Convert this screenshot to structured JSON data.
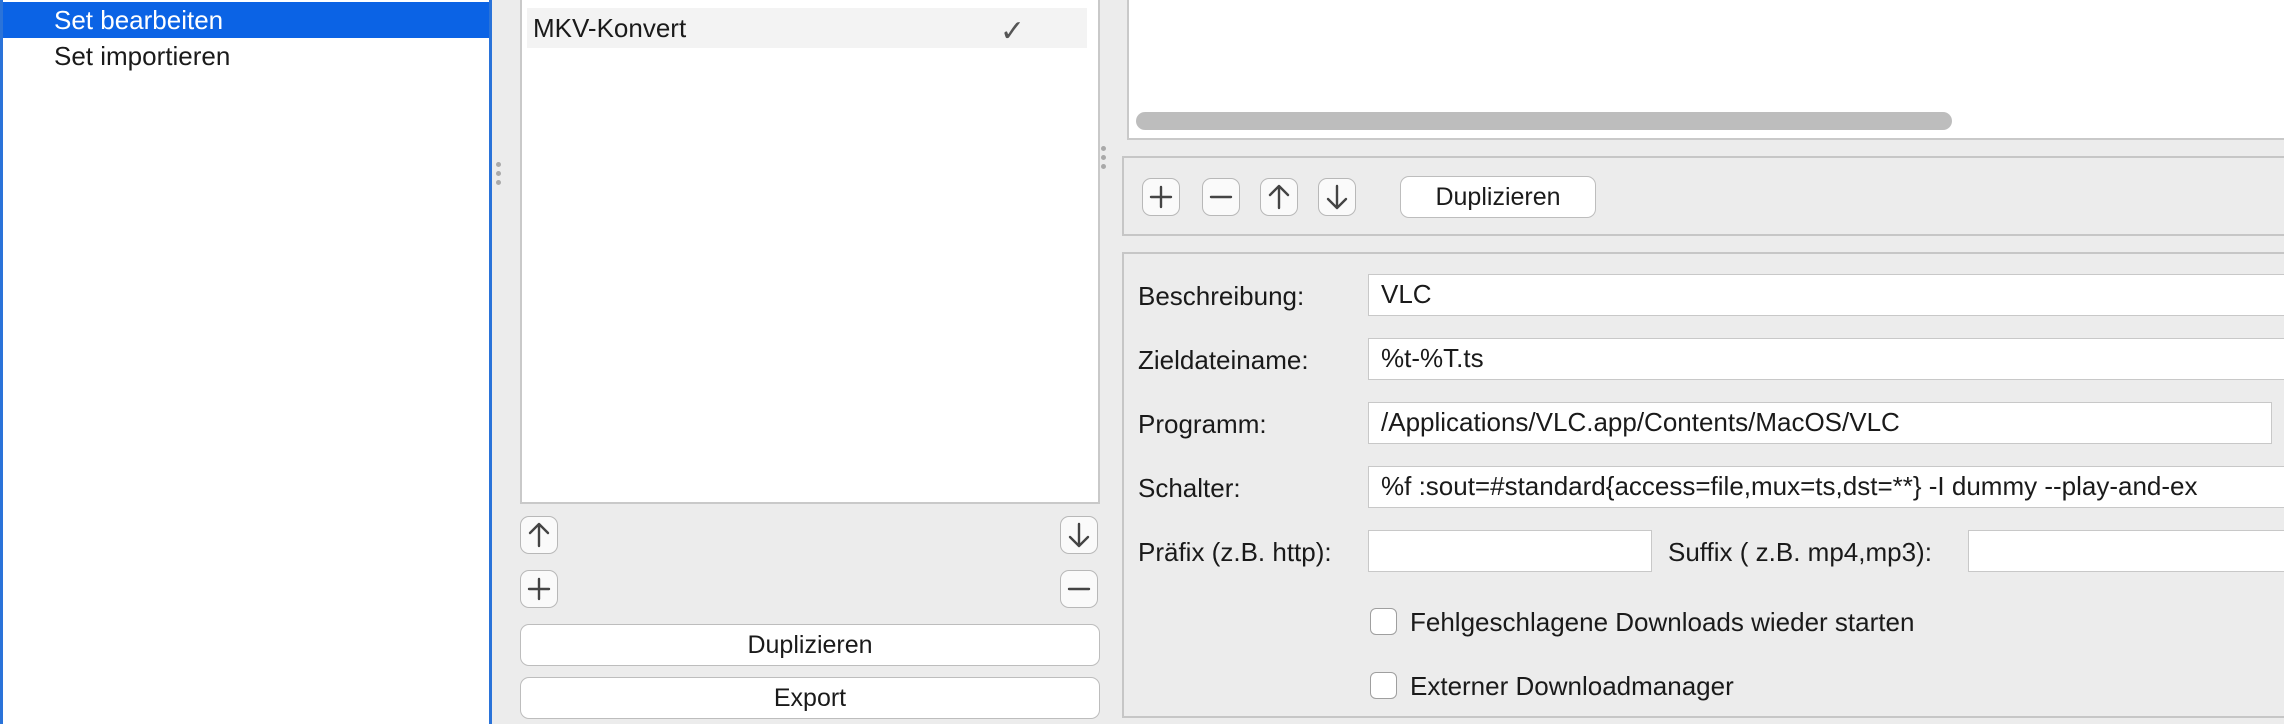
{
  "nav": {
    "items": [
      {
        "label": "Set bearbeiten",
        "selected": true
      },
      {
        "label": "Set importieren",
        "selected": false
      }
    ],
    "selection_color": "#0b63e5"
  },
  "set_list": {
    "rows": [
      {
        "label": "MKV-Konvert",
        "checked": true
      }
    ],
    "duplicate_label": "Duplizieren",
    "export_label": "Export"
  },
  "program_toolbar": {
    "duplicate_label": "Duplizieren"
  },
  "program_form": {
    "description_label": "Beschreibung:",
    "description_value": "VLC",
    "target_label": "Zieldateiname:",
    "target_value": "%t-%T.ts",
    "program_label": "Programm:",
    "program_value": "/Applications/VLC.app/Contents/MacOS/VLC",
    "switch_label": "Schalter:",
    "switch_value": "%f :sout=#standard{access=file,mux=ts,dst=**} -I dummy --play-and-ex",
    "prefix_label": "Präfix (z.B. http):",
    "prefix_value": "",
    "suffix_label": "Suffix ( z.B. mp4,mp3):",
    "suffix_value": "",
    "restart_label": "Fehlgeschlagene Downloads wieder starten",
    "restart_checked": false,
    "external_label": "Externer Downloadmanager",
    "external_checked": false
  }
}
